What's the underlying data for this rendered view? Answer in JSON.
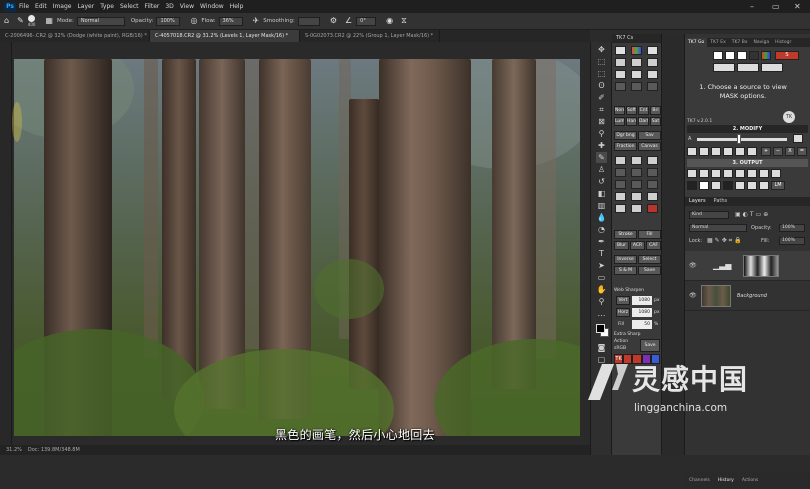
{
  "menu": {
    "app_icon": "Ps",
    "items": [
      "File",
      "Edit",
      "Image",
      "Layer",
      "Type",
      "Select",
      "Filter",
      "3D",
      "View",
      "Window",
      "Help"
    ]
  },
  "window_controls": {
    "minimize": "–",
    "restore": "▭",
    "close": "✕"
  },
  "options_bar": {
    "mode_label": "Mode:",
    "mode_value": "Normal",
    "opacity_label": "Opacity:",
    "opacity_value": "100%",
    "flow_label": "Flow:",
    "flow_value": "36%",
    "smoothing_label": "Smoothing:",
    "angle_value": "0°",
    "brush_size": "400"
  },
  "document_tabs": [
    {
      "label": "C-2006496-.CR2 @ 32% (Dodge (white paint), RGB/16) *",
      "active": false
    },
    {
      "label": "C-4057018.CR2 @ 31.2% (Levels 1, Layer Mask/16) *",
      "active": true
    },
    {
      "label": "S-0G02073.CR2 @ 22% (Group 1, Layer Mask/16) *",
      "active": false
    }
  ],
  "status_bar": {
    "zoom": "31.2%",
    "doc_info": "Doc: 139.8M/348.8M"
  },
  "subtitle": "黑色的画笔，然后小心地回去",
  "tk7_panel": {
    "header": "TK7 Cs",
    "rows": [
      [
        "Norm",
        "Soft",
        "Cnt",
        "Bri"
      ],
      [
        "Lum",
        "Hard",
        "Dark",
        "Sat"
      ]
    ],
    "dodge_burn": [
      "Dgr bng",
      "Sav"
    ],
    "fraction": [
      "Fraction",
      "Canvas"
    ],
    "stroke_fill": [
      "Stroke",
      "Fill"
    ],
    "blur_acr": [
      "Blur",
      "ACR",
      "CAF"
    ],
    "inverse_select": [
      "Inverse",
      "Select"
    ],
    "sm_save": [
      "S & M",
      "Save"
    ],
    "web_sharpen": "Web Sharpen",
    "vert_label": "Vert",
    "vert_value": "1080",
    "horz_label": "Horz",
    "horz_value": "1080",
    "fill_label": "Fill",
    "fill_value": "50",
    "unit_px": "px",
    "unit_pct": "%",
    "extra_sharp": "Extra Sharp",
    "action_label": "Action",
    "srgb_label": "sRGB",
    "save_label": "Save",
    "tk_label": "TK"
  },
  "right_tabs": [
    "TK7 Go",
    "TK7 Ex",
    "TK7 Bx",
    "Naviga",
    "Histogr"
  ],
  "tk_go": {
    "message": "1. Choose a source to view MASK options.",
    "version": "TK7 v.2.0.1",
    "modify": "2. MODIFY",
    "output": "3. OUTPUT",
    "logo_text": "TK",
    "btn_a": "A",
    "btn_lm": "LM",
    "btn_x": "X",
    "btn_s": "S",
    "btn_plus": "+",
    "btn_minus": "−",
    "btn_eq": "="
  },
  "layers_panel": {
    "tabs": [
      "Layers",
      "Paths"
    ],
    "kind": "Kind",
    "blend": "Normal",
    "opacity_label": "Opacity:",
    "opacity": "100%",
    "lock_label": "Lock:",
    "fill_label": "Fill:",
    "fill": "100%",
    "layers": [
      {
        "name": "",
        "kind": "adjustment"
      },
      {
        "name": "Background",
        "kind": "image"
      }
    ]
  },
  "bottom_tabs": [
    "Channels",
    "History",
    "Actions"
  ],
  "watermark": {
    "cn": "灵感中国",
    "url": "lingganchina.com"
  },
  "colors": {
    "accent": "#31a8ff",
    "panel": "#333333",
    "tk_red": "#c0392b",
    "tk_purple": "#7b2fb5"
  }
}
